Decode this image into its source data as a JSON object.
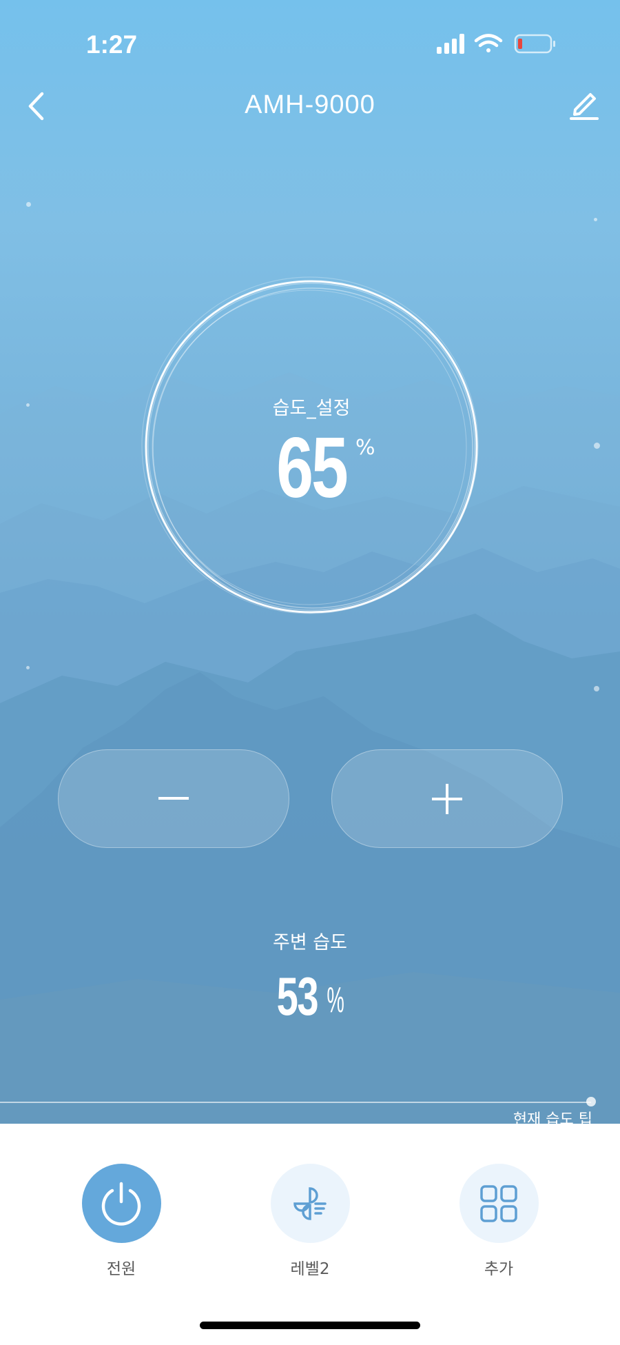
{
  "status_bar": {
    "time": "1:27"
  },
  "header": {
    "title": "AMH-9000"
  },
  "dial": {
    "label": "습도_설정",
    "value": "65",
    "unit": "%"
  },
  "ambient": {
    "label": "주변 습도",
    "value": "53",
    "unit": "%"
  },
  "tip": {
    "label": "현재 습도 팁"
  },
  "controls": [
    {
      "label": "전원",
      "icon": "power-icon"
    },
    {
      "label": "레벨2",
      "icon": "fan-level-icon"
    },
    {
      "label": "추가",
      "icon": "grid-icon"
    }
  ],
  "colors": {
    "accent": "#64a8db",
    "light_accent": "#ebf4fc",
    "sky_top": "#75c1ec"
  }
}
